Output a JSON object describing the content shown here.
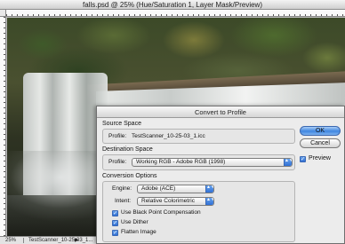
{
  "document": {
    "title": "falls.psd @ 25% (Hue/Saturation 1, Layer Mask/Preview)",
    "status": {
      "zoom": "25%",
      "file_info": "TestScanner_10-25-03_1...",
      "arrow": "▶"
    }
  },
  "dialog": {
    "title": "Convert to Profile",
    "source_space": {
      "heading": "Source Space",
      "profile_label": "Profile:",
      "profile_value": "TestScanner_10-25-03_1.icc"
    },
    "destination_space": {
      "heading": "Destination Space",
      "profile_label": "Profile:",
      "profile_value": "Working RGB - Adobe RGB (1998)"
    },
    "conversion_options": {
      "heading": "Conversion Options",
      "engine_label": "Engine:",
      "engine_value": "Adobe (ACE)",
      "intent_label": "Intent:",
      "intent_value": "Relative Colorimetric",
      "checkboxes": [
        {
          "label": "Use Black Point Compensation",
          "checked": true
        },
        {
          "label": "Use Dither",
          "checked": true
        },
        {
          "label": "Flatten Image",
          "checked": true
        }
      ]
    },
    "buttons": {
      "ok": "OK",
      "cancel": "Cancel"
    },
    "preview": {
      "label": "Preview",
      "checked": true
    },
    "check_glyph": "✓",
    "popup_arrows_glyph": "▲▼"
  }
}
